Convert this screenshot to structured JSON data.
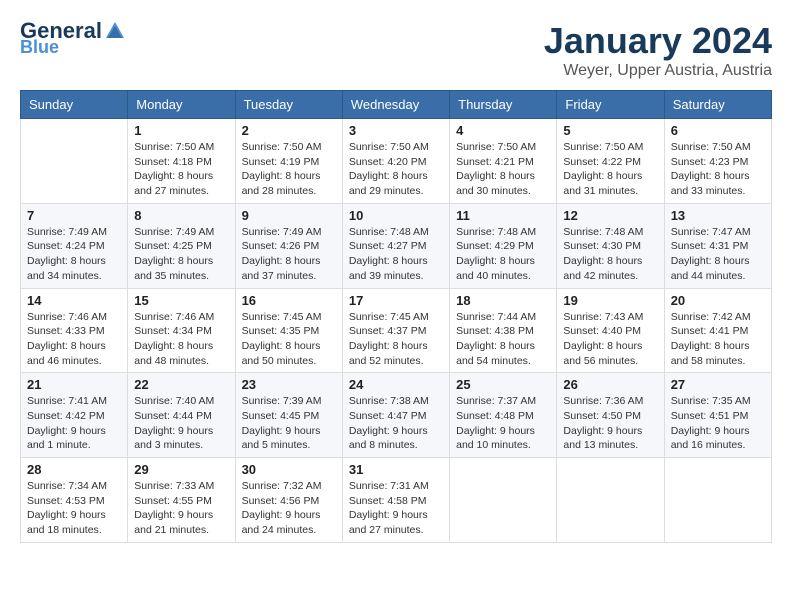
{
  "logo": {
    "line1": "General",
    "line2": "Blue",
    "tagline": ""
  },
  "title": "January 2024",
  "subtitle": "Weyer, Upper Austria, Austria",
  "weekdays": [
    "Sunday",
    "Monday",
    "Tuesday",
    "Wednesday",
    "Thursday",
    "Friday",
    "Saturday"
  ],
  "weeks": [
    [
      {
        "day": "",
        "info": ""
      },
      {
        "day": "1",
        "info": "Sunrise: 7:50 AM\nSunset: 4:18 PM\nDaylight: 8 hours\nand 27 minutes."
      },
      {
        "day": "2",
        "info": "Sunrise: 7:50 AM\nSunset: 4:19 PM\nDaylight: 8 hours\nand 28 minutes."
      },
      {
        "day": "3",
        "info": "Sunrise: 7:50 AM\nSunset: 4:20 PM\nDaylight: 8 hours\nand 29 minutes."
      },
      {
        "day": "4",
        "info": "Sunrise: 7:50 AM\nSunset: 4:21 PM\nDaylight: 8 hours\nand 30 minutes."
      },
      {
        "day": "5",
        "info": "Sunrise: 7:50 AM\nSunset: 4:22 PM\nDaylight: 8 hours\nand 31 minutes."
      },
      {
        "day": "6",
        "info": "Sunrise: 7:50 AM\nSunset: 4:23 PM\nDaylight: 8 hours\nand 33 minutes."
      }
    ],
    [
      {
        "day": "7",
        "info": "Sunrise: 7:49 AM\nSunset: 4:24 PM\nDaylight: 8 hours\nand 34 minutes."
      },
      {
        "day": "8",
        "info": "Sunrise: 7:49 AM\nSunset: 4:25 PM\nDaylight: 8 hours\nand 35 minutes."
      },
      {
        "day": "9",
        "info": "Sunrise: 7:49 AM\nSunset: 4:26 PM\nDaylight: 8 hours\nand 37 minutes."
      },
      {
        "day": "10",
        "info": "Sunrise: 7:48 AM\nSunset: 4:27 PM\nDaylight: 8 hours\nand 39 minutes."
      },
      {
        "day": "11",
        "info": "Sunrise: 7:48 AM\nSunset: 4:29 PM\nDaylight: 8 hours\nand 40 minutes."
      },
      {
        "day": "12",
        "info": "Sunrise: 7:48 AM\nSunset: 4:30 PM\nDaylight: 8 hours\nand 42 minutes."
      },
      {
        "day": "13",
        "info": "Sunrise: 7:47 AM\nSunset: 4:31 PM\nDaylight: 8 hours\nand 44 minutes."
      }
    ],
    [
      {
        "day": "14",
        "info": "Sunrise: 7:46 AM\nSunset: 4:33 PM\nDaylight: 8 hours\nand 46 minutes."
      },
      {
        "day": "15",
        "info": "Sunrise: 7:46 AM\nSunset: 4:34 PM\nDaylight: 8 hours\nand 48 minutes."
      },
      {
        "day": "16",
        "info": "Sunrise: 7:45 AM\nSunset: 4:35 PM\nDaylight: 8 hours\nand 50 minutes."
      },
      {
        "day": "17",
        "info": "Sunrise: 7:45 AM\nSunset: 4:37 PM\nDaylight: 8 hours\nand 52 minutes."
      },
      {
        "day": "18",
        "info": "Sunrise: 7:44 AM\nSunset: 4:38 PM\nDaylight: 8 hours\nand 54 minutes."
      },
      {
        "day": "19",
        "info": "Sunrise: 7:43 AM\nSunset: 4:40 PM\nDaylight: 8 hours\nand 56 minutes."
      },
      {
        "day": "20",
        "info": "Sunrise: 7:42 AM\nSunset: 4:41 PM\nDaylight: 8 hours\nand 58 minutes."
      }
    ],
    [
      {
        "day": "21",
        "info": "Sunrise: 7:41 AM\nSunset: 4:42 PM\nDaylight: 9 hours\nand 1 minute."
      },
      {
        "day": "22",
        "info": "Sunrise: 7:40 AM\nSunset: 4:44 PM\nDaylight: 9 hours\nand 3 minutes."
      },
      {
        "day": "23",
        "info": "Sunrise: 7:39 AM\nSunset: 4:45 PM\nDaylight: 9 hours\nand 5 minutes."
      },
      {
        "day": "24",
        "info": "Sunrise: 7:38 AM\nSunset: 4:47 PM\nDaylight: 9 hours\nand 8 minutes."
      },
      {
        "day": "25",
        "info": "Sunrise: 7:37 AM\nSunset: 4:48 PM\nDaylight: 9 hours\nand 10 minutes."
      },
      {
        "day": "26",
        "info": "Sunrise: 7:36 AM\nSunset: 4:50 PM\nDaylight: 9 hours\nand 13 minutes."
      },
      {
        "day": "27",
        "info": "Sunrise: 7:35 AM\nSunset: 4:51 PM\nDaylight: 9 hours\nand 16 minutes."
      }
    ],
    [
      {
        "day": "28",
        "info": "Sunrise: 7:34 AM\nSunset: 4:53 PM\nDaylight: 9 hours\nand 18 minutes."
      },
      {
        "day": "29",
        "info": "Sunrise: 7:33 AM\nSunset: 4:55 PM\nDaylight: 9 hours\nand 21 minutes."
      },
      {
        "day": "30",
        "info": "Sunrise: 7:32 AM\nSunset: 4:56 PM\nDaylight: 9 hours\nand 24 minutes."
      },
      {
        "day": "31",
        "info": "Sunrise: 7:31 AM\nSunset: 4:58 PM\nDaylight: 9 hours\nand 27 minutes."
      },
      {
        "day": "",
        "info": ""
      },
      {
        "day": "",
        "info": ""
      },
      {
        "day": "",
        "info": ""
      }
    ]
  ]
}
